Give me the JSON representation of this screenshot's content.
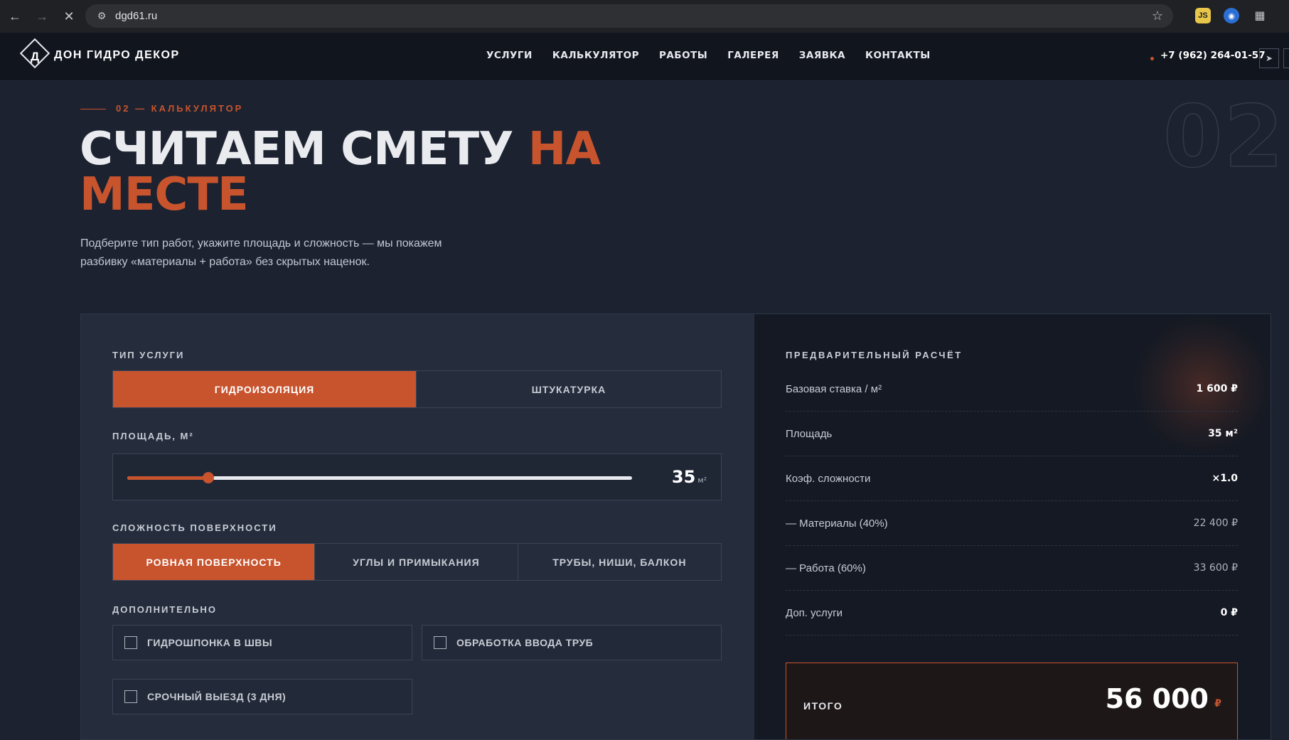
{
  "browser": {
    "url": "dgd61.ru"
  },
  "header": {
    "logo_letter": "Д",
    "logo_text": "ДОН ГИДРО ДЕКОР",
    "nav": [
      "УСЛУГИ",
      "КАЛЬКУЛЯТОР",
      "РАБОТЫ",
      "ГАЛЕРЕЯ",
      "ЗАЯВКА",
      "КОНТАКТЫ"
    ],
    "phone": "+7 (962) 264-01-57"
  },
  "section": {
    "kicker": "02 — КАЛЬКУЛЯТОР",
    "big_number": "02",
    "title_main": "СЧИТАЕМ СМЕТУ ",
    "title_accent": "НА МЕСТЕ",
    "lead": "Подберите тип работ, укажите площадь и сложность — мы покажем разбивку «материалы + работа» без скрытых наценок."
  },
  "calculator": {
    "service_label": "ТИП УСЛУГИ",
    "services": [
      "ГИДРОИЗОЛЯЦИЯ",
      "ШТУКАТУРКА"
    ],
    "area_label": "ПЛОЩАДЬ, М²",
    "area_value": "35",
    "area_unit": "м²",
    "area_fraction": 0.16,
    "complexity_label": "СЛОЖНОСТЬ ПОВЕРХНОСТИ",
    "complexity": [
      "РОВНАЯ ПОВЕРХНОСТЬ",
      "УГЛЫ И ПРИМЫКАНИЯ",
      "ТРУБЫ, НИШИ, БАЛКОН"
    ],
    "extras_label": "ДОПОЛНИТЕЛЬНО",
    "extras": [
      "ГИДРОШПОНКА В ШВЫ",
      "ОБРАБОТКА ВВОДА ТРУБ",
      "СРОЧНЫЙ ВЫЕЗД (3 ДНЯ)"
    ]
  },
  "summary": {
    "title": "ПРЕДВАРИТЕЛЬНЫЙ РАСЧЁТ",
    "rows": [
      {
        "k": "Базовая ставка / м²",
        "v": "1 600 ₽"
      },
      {
        "k": "Площадь",
        "v": "35 м²"
      },
      {
        "k": "Коэф. сложности",
        "v": "×1.0"
      },
      {
        "k": "— Материалы (40%)",
        "v": "22 400 ₽"
      },
      {
        "k": "— Работа (60%)",
        "v": "33 600 ₽"
      },
      {
        "k": "Доп. услуги",
        "v": "0 ₽"
      }
    ],
    "total_label": "ИТОГО",
    "total_value": "56 000",
    "total_currency": "₽"
  },
  "colors": {
    "accent": "#c8542e",
    "bg": "#1c2230",
    "panel": "#252d3d",
    "panel_dark": "#141923"
  }
}
